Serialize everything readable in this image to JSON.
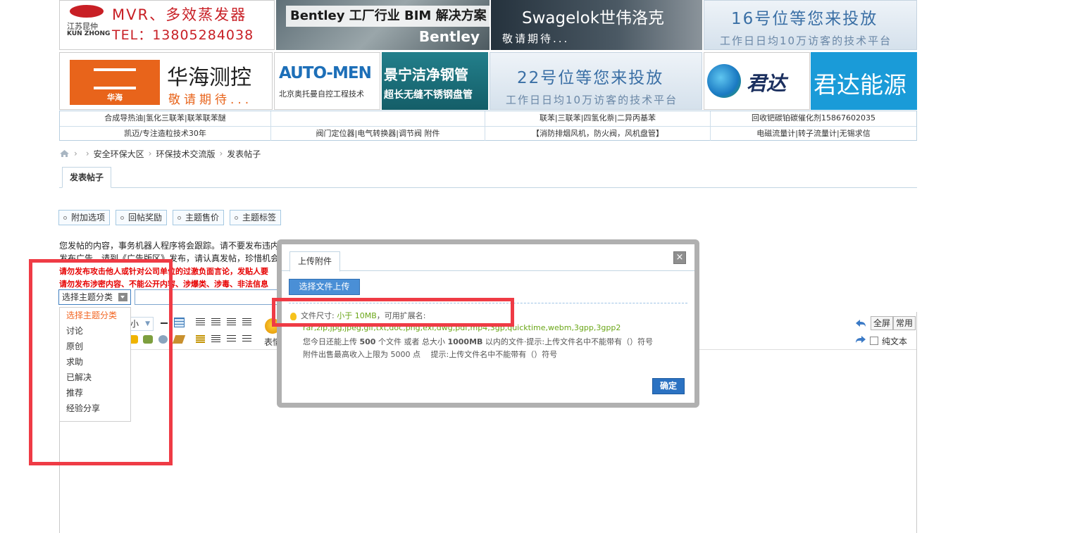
{
  "banners": {
    "row1": [
      {
        "brand": "江苏昆仲",
        "brand2": "KUN ZHONG",
        "line1": "MVR、多效蒸发器",
        "line2": "TEL：13805284038",
        "bg": "#ffffff",
        "fg": "#c81f25"
      },
      {
        "line1": "Bentley 工厂行业 BIM 解决方案",
        "line2": "Bentley",
        "bg": "#7d8a8f",
        "fg": "#1a1a1a"
      },
      {
        "line1": "Swagelok世伟洛克",
        "line2": "敬请期待...",
        "bg": "#2f3d49",
        "fg": "#ffffff"
      },
      {
        "line1": "16号位等您来投放",
        "line2": "工作日日均10万访客的技术平台",
        "bg": "#dbe6f0",
        "fg": "#3a6fa5"
      }
    ],
    "row2": [
      {
        "logo": "华海",
        "line1": "华海测控",
        "line2": "敬请期待...",
        "bg": "#ffffff",
        "fg": "#222222"
      },
      {
        "line1": "AUTO-MEN",
        "line2": "北京奥托曼自控工程技术",
        "bg": "#ffffff",
        "fg": "#1d6fb8"
      },
      {
        "line1": "景宁洁净钢管",
        "line2": "超长无缝不锈钢盘管",
        "bg": "#1e7a86",
        "fg": "#ffffff"
      },
      {
        "line1": "22号位等您来投放",
        "line2": "工作日日均10万访客的技术平台",
        "bg": "#dbe6f0",
        "fg": "#3a6fa5"
      },
      {
        "line1": "君达",
        "bg": "#ffffff",
        "fg": "#1b2f5e"
      },
      {
        "line1": "君达能源",
        "bg": "#1a9bd8",
        "fg": "#ffffff"
      }
    ]
  },
  "link_rows": [
    [
      "合成导热油|氢化三联苯|联苯联苯醚",
      "",
      "联苯|三联苯|四氢化萘|二异丙基苯",
      "回收钯碳铂碳催化剂15867602035"
    ],
    [
      "凯迈/专注造粒技术30年",
      "阀门定位器|电气转换器|调节阀 附件",
      "【消防排烟风机，防火阀，风机盘管】",
      "电磁流量计|转子流量计|无锡求信"
    ]
  ],
  "breadcrumb": [
    "安全环保大区",
    "环保技术交流版",
    "发表帖子"
  ],
  "tab_label": "发表帖子",
  "option_buttons": [
    "附加选项",
    "回帖奖励",
    "主题售价",
    "主题标签"
  ],
  "notices": {
    "line1": "您发帖的内容，事务机器人程序将会跟踪。请不要发布违内容",
    "line2": "发布广告，请到《广告版区》发布，请认真发帖，珍惜机会",
    "red1": "请勿发布攻击他人或针对公司单位的过激负面言论，发贴人要",
    "red2": "请勿发布涉密内容、不能公开内容、涉爆类、涉毒、非法信息"
  },
  "type_select": {
    "value": "选择主题分类",
    "options": [
      "选择主题分类",
      "讨论",
      "原创",
      "求助",
      "已解决",
      "推荐",
      "经验分享"
    ]
  },
  "editor": {
    "font_size": "小",
    "emoji_label": "表情",
    "fullscreen": "全屏",
    "common": "常用",
    "plain_text": "纯文本"
  },
  "upload_dialog": {
    "tab": "上传附件",
    "pick_button": "选择文件上传",
    "size_label": "文件尺寸:",
    "size_value": "小于 10MB",
    "ext_label": "，可用扩展名:",
    "extensions": "rar,zip,jpg,jpeg,gif,txt,doc,png,exl,dwg,pdf,mp4,3gp,quicktime,webm,3gpp,3gpp2",
    "quota_pre": "您今日还能上传",
    "quota_count": "500",
    "quota_mid": "个文件 或者 总大小",
    "quota_size": "1000MB",
    "quota_post": "以内的文件·提示:上传文件名中不能带有（）符号",
    "income_line": "附件出售最高收入上限为 5000 点　 提示:上传文件名中不能带有（）符号",
    "ok": "确定",
    "close": "×"
  }
}
